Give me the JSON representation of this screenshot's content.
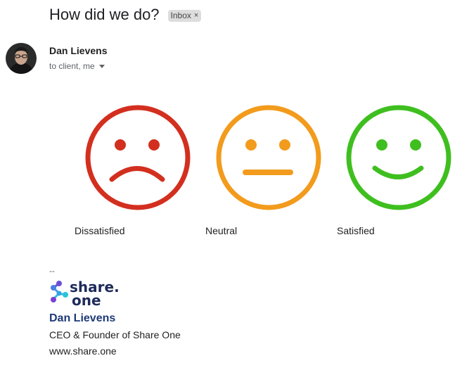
{
  "email": {
    "subject": "How did we do?",
    "label_chip": "Inbox",
    "label_chip_close": "×",
    "sender_name": "Dan Lievens",
    "recipients": "to client, me"
  },
  "survey": {
    "options": [
      {
        "label": "Dissatisfied",
        "color": "#d32f1f"
      },
      {
        "label": "Neutral",
        "color": "#f29b1c"
      },
      {
        "label": "Satisfied",
        "color": "#3fbf1f"
      }
    ]
  },
  "signature": {
    "separator": "--",
    "logo_line1": "share.",
    "logo_line2": "one",
    "name": "Dan Lievens",
    "title": "CEO & Founder of Share One",
    "website": "www.share.one",
    "brand_color": "#1e3a78"
  },
  "icons": {
    "chip_close": "close-icon",
    "recipients_expand": "caret-down-icon"
  }
}
